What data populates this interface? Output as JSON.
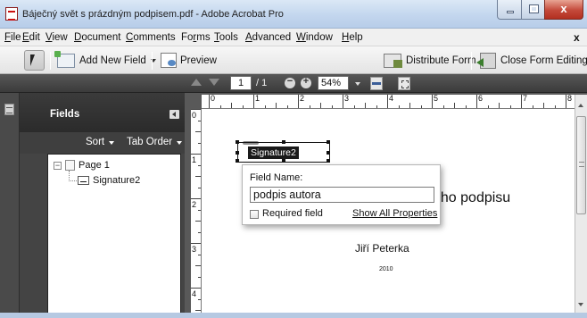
{
  "window": {
    "title": "Báječný svět s prázdným podpisem.pdf - Adobe Acrobat Pro",
    "close_glyph": "x"
  },
  "menu": {
    "items": [
      {
        "u": "F",
        "rest": "ile"
      },
      {
        "u": "E",
        "rest": "dit"
      },
      {
        "u": "V",
        "rest": "iew"
      },
      {
        "u": "D",
        "rest": "ocument"
      },
      {
        "u": "C",
        "rest": "omments"
      },
      {
        "pre": "Fo",
        "u": "r",
        "rest": "ms"
      },
      {
        "u": "T",
        "rest": "ools"
      },
      {
        "u": "A",
        "rest": "dvanced"
      },
      {
        "u": "W",
        "rest": "indow"
      },
      {
        "u": "H",
        "rest": "elp"
      }
    ],
    "close_glyph": "x"
  },
  "toolbar": {
    "add_new_field": "Add New Field",
    "preview": "Preview",
    "distribute_form": "Distribute Form",
    "close_form_editing": "Close Form Editing"
  },
  "navigation": {
    "current_page": "1",
    "total_pages": "/ 1",
    "zoom": "54%"
  },
  "fields_panel": {
    "title": "Fields",
    "sort_label": "Sort",
    "tab_order_label": "Tab Order",
    "tree": {
      "toggle": "−",
      "page_node": "Page 1",
      "field_node": "Signature2"
    }
  },
  "rulers": {
    "horizontal": [
      "0",
      "1",
      "2",
      "3",
      "4",
      "5",
      "6",
      "7",
      "8"
    ],
    "vertical": [
      "0",
      "1",
      "2",
      "3",
      "4"
    ]
  },
  "document": {
    "signature_field_label": "Signature2",
    "heading_fragment": "ého podpisu",
    "author": "Jiří Peterka",
    "year": "2010"
  },
  "field_popup": {
    "field_name_label": "Field Name:",
    "field_name_value": "podpis autora",
    "required_label": "Required field",
    "required_checked": false,
    "show_all_properties": "Show All Properties"
  },
  "colors": {
    "accent_close_button": "#c4493a",
    "dark_chrome": "#3a3a3a",
    "title_bar": "#c3d6ee"
  }
}
